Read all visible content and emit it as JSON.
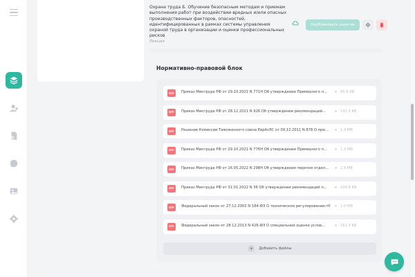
{
  "lesson": {
    "title": "Охрана труда Б. Обучение безопасным методам и приемам выполнения работ при воздействии вредных и/или опасных производственных факторов, опасностей, идентифицированных в рамках системы управления охраной труда в организации и оценки профессиональных рисков",
    "type_label": "Лекция",
    "publish_label": "Опубликовать занятие"
  },
  "section": {
    "title": "Нормативно-правовой блок"
  },
  "documents": [
    {
      "badge": "RTF",
      "name": "Приказ Минтруда РФ от 29.10.2021 N 771Н Об утверждении Примерного п...",
      "size": "65.6 KB"
    },
    {
      "badge": "RTF",
      "name": "Приказ Минтруда РФ от 28.12.2021 N 926 Об утверждении рекомендаций...",
      "size": "141.3 KB"
    },
    {
      "badge": "RTF",
      "name": "Решение Комиссии Таможенного союза ЕврАзЭС от 09.12.2011 N 878 О при...",
      "size": "1.4 MB"
    },
    {
      "badge": "RTF",
      "name": "Приказ Минтруда РФ от 29.10.2021 N 776Н Об утверждении Примерного п...",
      "size": "1.3 MB"
    },
    {
      "badge": "RTF",
      "name": "Приказ Минтруда РФ от 16.05.2022 N 298Н Об утверждении перечня отдел...",
      "size": "2.9 MB"
    },
    {
      "badge": "RTF",
      "name": "Приказ Минтруда РФ от 31.01.2022 N 36 Об утверждении рекомендаций п...",
      "size": "104.9 KB"
    },
    {
      "badge": "RTF",
      "name": "Федеральный закон от 27.12.2002 N 184-ФЗ О техническом регулировании.rtf",
      "size": "1.0 MB"
    },
    {
      "badge": "RTF",
      "name": "Федеральный закон от 28.12.2013 N 426-ФЗ О специальной оценке услов...",
      "size": "162.3 KB"
    }
  ],
  "add_files_label": "Добавить файлы",
  "icons": {
    "rail": [
      "menu-icon",
      "layers-icon",
      "user-icon",
      "document-icon",
      "chat-bubble-icon",
      "image-icon",
      "gear-icon"
    ],
    "cloud": "cloud-check-icon",
    "gear": "gear-icon",
    "delete": "trash-icon",
    "chat": "chat-icon"
  },
  "colors": {
    "accent": "#2fb8a0",
    "publish_disabled": "#a9dfd4",
    "danger": "#e5484d",
    "badge": "#f0767a"
  }
}
